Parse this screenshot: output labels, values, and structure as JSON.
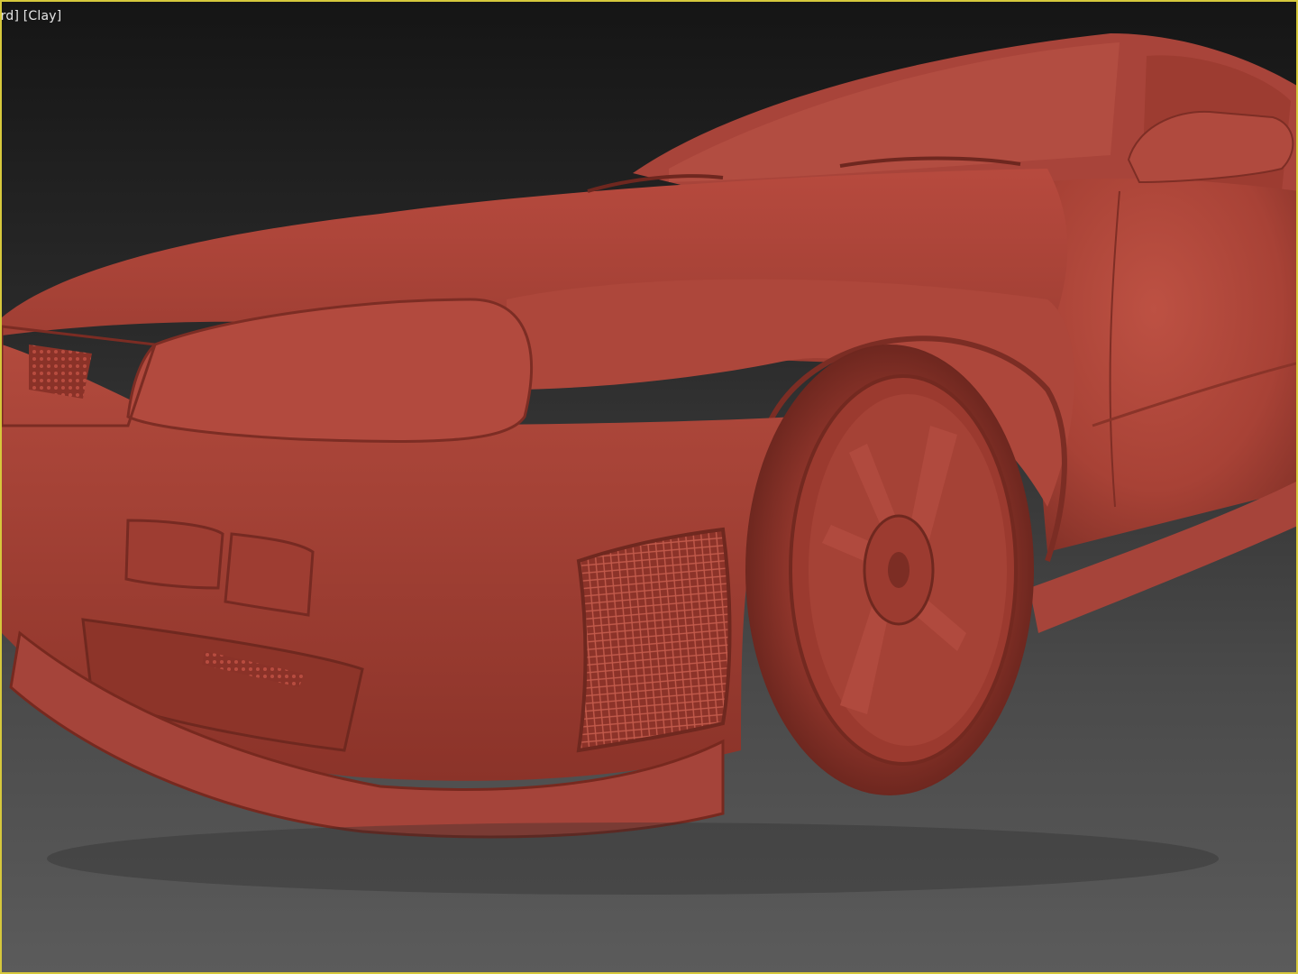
{
  "viewport": {
    "label_view": "rd",
    "label_shading": "Clay",
    "accent_border": "#d6c83c",
    "model_color": "#b0483c"
  }
}
